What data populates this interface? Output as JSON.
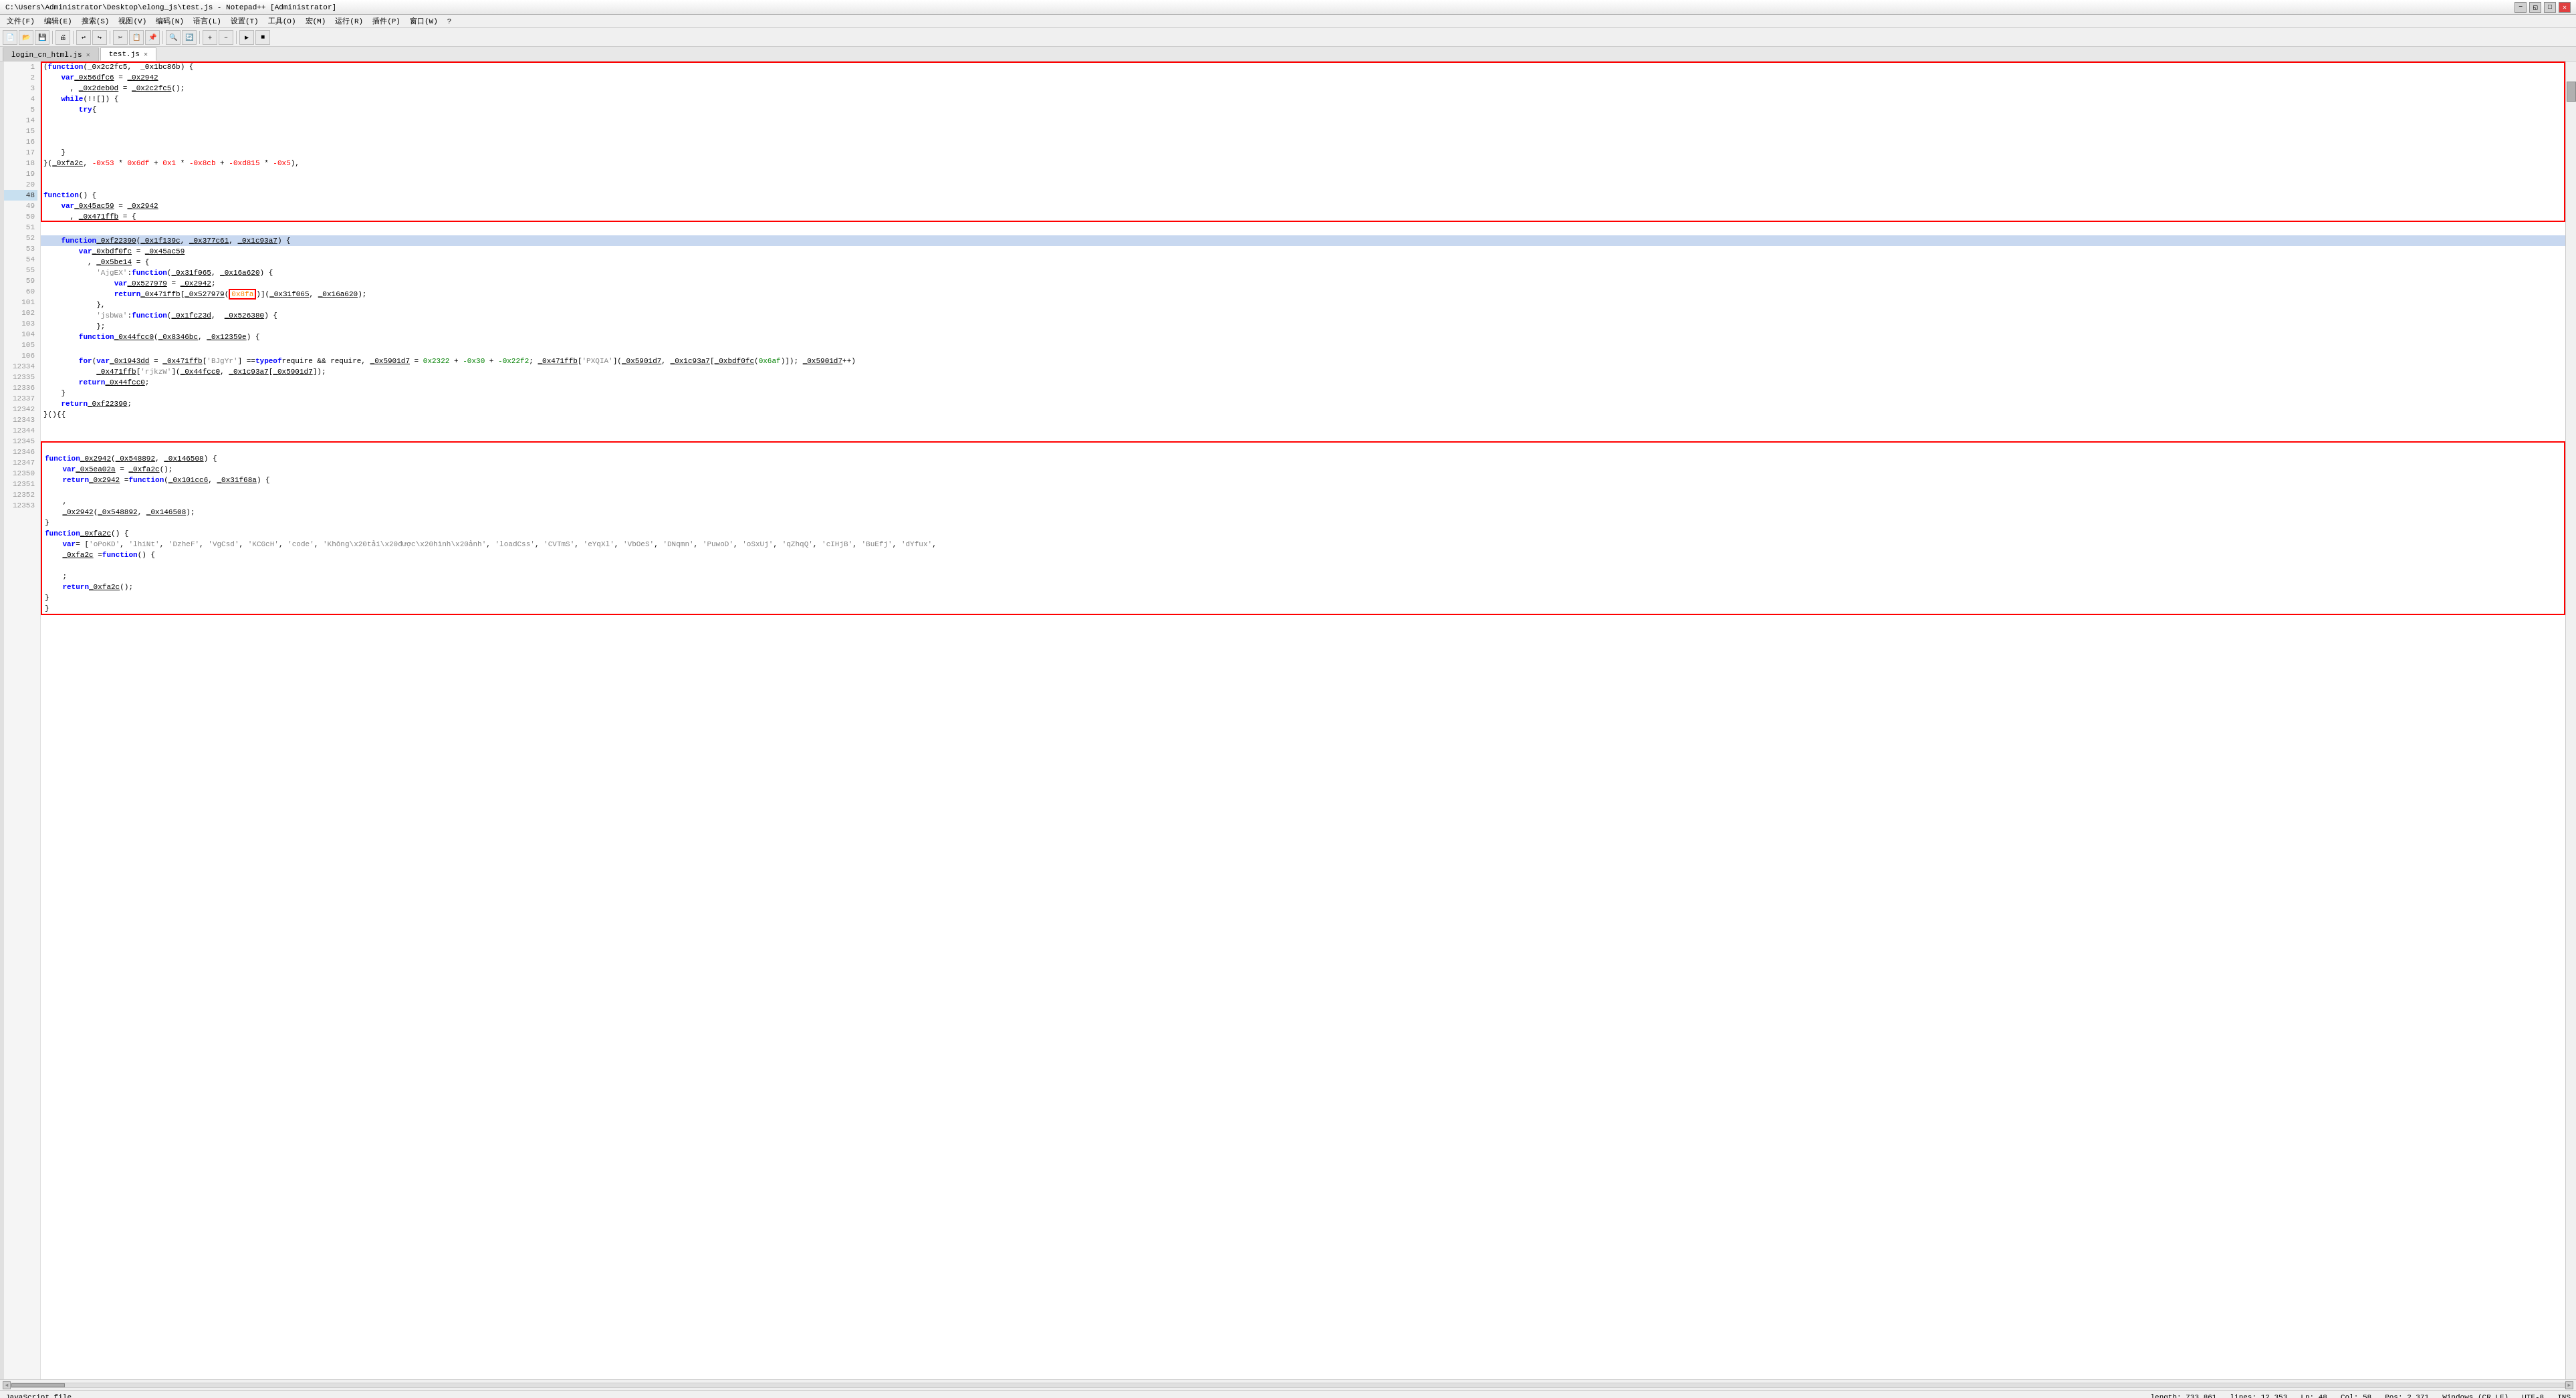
{
  "window": {
    "title": "C:\\Users\\Administrator\\Desktop\\elong_js\\test.js - Notepad++ [Administrator]",
    "minimize_label": "−",
    "maximize_label": "□",
    "close_label": "✕",
    "resize_label": "◱"
  },
  "menu": {
    "items": [
      "文件(F)",
      "编辑(E)",
      "搜索(S)",
      "视图(V)",
      "编码(N)",
      "语言(L)",
      "设置(T)",
      "工具(O)",
      "宏(M)",
      "运行(R)",
      "插件(P)",
      "窗口(W)",
      "?"
    ]
  },
  "tabs": [
    {
      "label": "login_cn_html.js",
      "active": false
    },
    {
      "label": "test.js",
      "active": true
    }
  ],
  "status_bar": {
    "file_type": "JavaScript file",
    "length": "length: 733,861",
    "lines": "lines: 12,353",
    "ln": "Ln: 48",
    "col": "Col: 58",
    "pos": "Pos: 2,371",
    "line_ending": "Windows (CR LF)",
    "encoding": "UTF-8",
    "ins": "INS"
  },
  "code": {
    "lines": [
      {
        "num": "1",
        "content": "(function(_0x2c2fc5,  _0x1bc86b) {",
        "highlight": false,
        "change": "green"
      },
      {
        "num": "2",
        "content": "    var _0x56dfc6 = _0x2942",
        "highlight": false,
        "change": "green"
      },
      {
        "num": "3",
        "content": "      , _0x2deb0d = _0x2c2fc5();",
        "highlight": false,
        "change": "green"
      },
      {
        "num": "4",
        "content": "    while (!![]) {",
        "highlight": false,
        "change": "green"
      },
      {
        "num": "5",
        "content": "        try {",
        "highlight": false,
        "change": "green"
      },
      {
        "num": "14",
        "content": "    }",
        "highlight": false,
        "change": "none"
      },
      {
        "num": "15",
        "content": "}(_0xfa2c, -0x53 * 0x6df + 0x1 * -0x8cb + -0xd815 * -0x5),",
        "highlight": false,
        "change": "none"
      },
      {
        "num": "16",
        "content": "",
        "highlight": false,
        "change": "none"
      },
      {
        "num": "17",
        "content": "",
        "highlight": false,
        "change": "none"
      },
      {
        "num": "18",
        "content": "function() {",
        "highlight": false,
        "change": "none"
      },
      {
        "num": "19",
        "content": "    var _0x45ac59 = _0x2942",
        "highlight": false,
        "change": "none"
      },
      {
        "num": "20",
        "content": "      , _0x471ffb = {",
        "highlight": false,
        "change": "none"
      },
      {
        "num": "48",
        "content": "    function _0xf22390(_0x1f139c, _0x377c61, _0x1c93a7) {",
        "highlight": true,
        "change": "none"
      },
      {
        "num": "49",
        "content": "        var _0xbdf0fc = _0x45ac59",
        "highlight": false,
        "change": "none"
      },
      {
        "num": "50",
        "content": "          , _0x5be14 = {",
        "highlight": false,
        "change": "none"
      },
      {
        "num": "51",
        "content": "            'AjgEX': function(_0x31f065, _0x16a620) {",
        "highlight": false,
        "change": "none"
      },
      {
        "num": "52",
        "content": "                var _0x527979 = _0x2942;",
        "highlight": false,
        "change": "none"
      },
      {
        "num": "53",
        "content": "                return _0x471ffb[_0x527979(0x8fa)](_0x31f065, _0x16a620);",
        "highlight": false,
        "change": "none"
      },
      {
        "num": "54",
        "content": "            },",
        "highlight": false,
        "change": "none"
      },
      {
        "num": "55",
        "content": "            'jsbWa': function(_0x1fc23d,  _0x526380) {",
        "highlight": false,
        "change": "none"
      },
      {
        "num": "59",
        "content": "            };",
        "highlight": false,
        "change": "none"
      },
      {
        "num": "60",
        "content": "        function _0x44fcc0(_0x8346bc, _0x12359e) {",
        "highlight": false,
        "change": "none"
      },
      {
        "num": "101",
        "content": "        for (var _0x1943dd = _0x471ffb['BJgYr'] == typeof require && require, _0x5901d7 = 0x2322 + -0x30 + -0x22f2; _0x471ffb['PXQIA'](_0x5901d7, _0x1c93a7[_0xbdf0fc(0x6af)]); _0x5901d7++)",
        "highlight": false,
        "change": "none"
      },
      {
        "num": "102",
        "content": "            _0x471ffb['rjkzW'](_0x44fcc0, _0x1c93a7[_0x5901d7]);",
        "highlight": false,
        "change": "none"
      },
      {
        "num": "103",
        "content": "        return _0x44fcc0;",
        "highlight": false,
        "change": "none"
      },
      {
        "num": "104",
        "content": "    }",
        "highlight": false,
        "change": "none"
      },
      {
        "num": "105",
        "content": "    return _0xf22390;",
        "highlight": false,
        "change": "none"
      },
      {
        "num": "106",
        "content": "}(){{",
        "highlight": false,
        "change": "none"
      },
      {
        "num": "12334",
        "content": "",
        "highlight": false,
        "change": "none"
      },
      {
        "num": "12335",
        "content": "function _0x2942(_0x548892, _0x146508) {",
        "highlight": false,
        "change": "none"
      },
      {
        "num": "12336",
        "content": "    var _0x5ea02a = _0xfa2c();",
        "highlight": false,
        "change": "none"
      },
      {
        "num": "12337",
        "content": "    return _0x2942 = function(_0x101cc6, _0x31f68a) {",
        "highlight": false,
        "change": "none"
      },
      {
        "num": "12342",
        "content": "    ,",
        "highlight": false,
        "change": "none"
      },
      {
        "num": "12343",
        "content": "    _0x2942(_0x548892, _0x146508);",
        "highlight": false,
        "change": "none"
      },
      {
        "num": "12344",
        "content": "}",
        "highlight": false,
        "change": "none"
      },
      {
        "num": "12345",
        "content": "function _0xfa2c() {",
        "highlight": false,
        "change": "none"
      },
      {
        "num": "12346",
        "content": "    var = ['oPoKD', 'lhiNt', 'DzheF', 'VgCsd', 'KCGcH', 'code', 'Không\\x20tải\\x20được\\x20hình\\x20ảnh', 'loadCss', 'CVTmS', 'eYqXl', 'VbOeS', 'DNqmn', 'PuwoD', 'oSxUj', 'qZhqQ', 'cIHjB', 'BuEfj', 'dYfux',",
        "highlight": false,
        "change": "none"
      },
      {
        "num": "12347",
        "content": "    _0xfa2c = function() {",
        "highlight": false,
        "change": "none"
      },
      {
        "num": "12350",
        "content": "    ;",
        "highlight": false,
        "change": "none"
      },
      {
        "num": "12351",
        "content": "    return _0xfa2c();",
        "highlight": false,
        "change": "none"
      },
      {
        "num": "12352",
        "content": "}",
        "highlight": false,
        "change": "none"
      },
      {
        "num": "12353",
        "content": "}",
        "highlight": false,
        "change": "none"
      }
    ]
  }
}
